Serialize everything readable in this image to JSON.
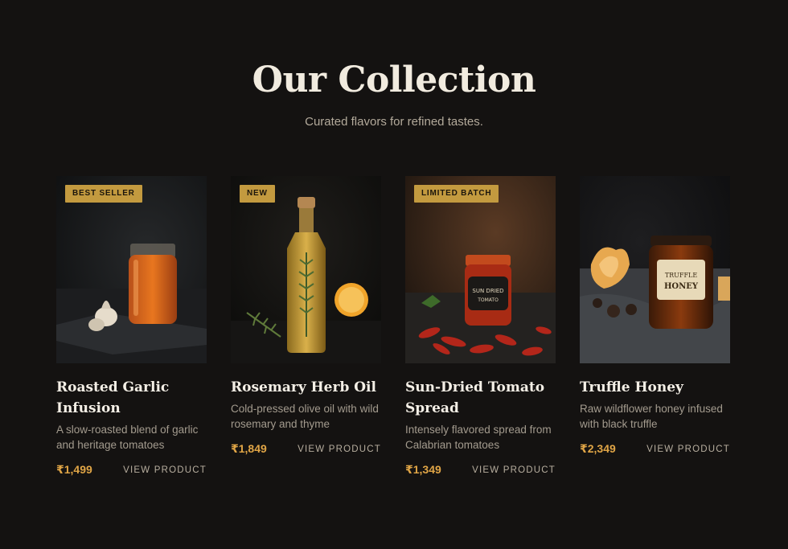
{
  "header": {
    "title": "Our Collection",
    "subtitle": "Curated flavors for refined tastes."
  },
  "products": [
    {
      "badge": "BEST SELLER",
      "name": "Roasted Garlic Infusion",
      "description": "A slow-roasted blend of garlic and heritage tomatoes",
      "price": "₹1,499",
      "cta": "VIEW PRODUCT",
      "image": "garlic-infusion-jar-photo"
    },
    {
      "badge": "NEW",
      "name": "Rosemary Herb Oil",
      "description": "Cold-pressed olive oil with wild rosemary and thyme",
      "price": "₹1,849",
      "cta": "VIEW PRODUCT",
      "image": "rosemary-oil-bottle-photo"
    },
    {
      "badge": "LIMITED BATCH",
      "name": "Sun-Dried Tomato Spread",
      "description": "Intensely flavored spread from Calabrian tomatoes",
      "price": "₹1,349",
      "cta": "VIEW PRODUCT",
      "image": "tomato-spread-jar-photo",
      "jar_label": [
        "SUN DRIED",
        "TOMATO"
      ]
    },
    {
      "name": "Truffle Honey",
      "description": "Raw wildflower honey infused with black truffle",
      "price": "₹2,349",
      "cta": "VIEW PRODUCT",
      "image": "truffle-honey-jar-photo",
      "jar_label": [
        "TRUFFLE",
        "HONEY"
      ]
    }
  ],
  "colors": {
    "background": "#141211",
    "badge": "#c39a3f",
    "price": "#e0a546"
  }
}
